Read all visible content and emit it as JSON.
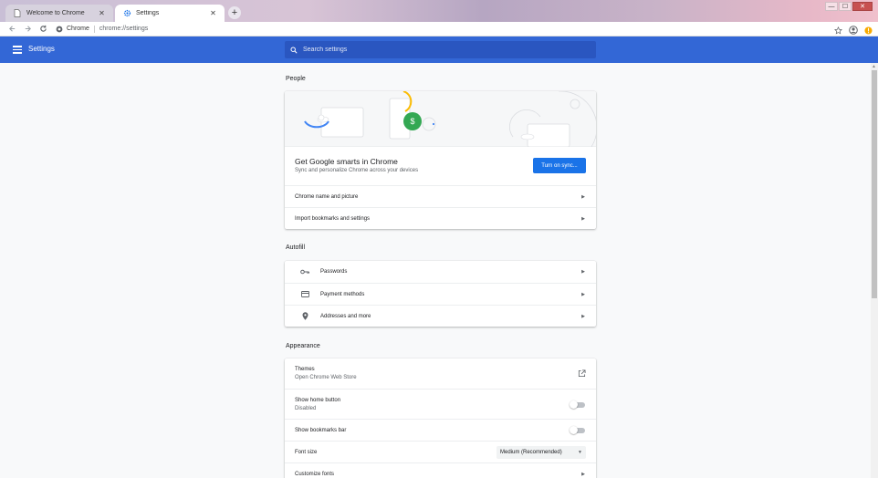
{
  "browser": {
    "tabs": [
      {
        "title": "Welcome to Chrome",
        "active": false
      },
      {
        "title": "Settings",
        "active": true
      }
    ],
    "new_tab_symbol": "+",
    "window_controls": {
      "minimize": "—",
      "maximize": "☐",
      "close": "✕"
    },
    "omnibox": {
      "site": "Chrome",
      "url": "chrome://settings"
    }
  },
  "header": {
    "title": "Settings",
    "search_placeholder": "Search settings",
    "color": "#3367d6"
  },
  "sections": {
    "people": {
      "title": "People",
      "smarts_title": "Get Google smarts in Chrome",
      "smarts_subtitle": "Sync and personalize Chrome across your devices",
      "sync_button": "Turn on sync...",
      "rows": [
        "Chrome name and picture",
        "Import bookmarks and settings"
      ]
    },
    "autofill": {
      "title": "Autofill",
      "rows": [
        {
          "label": "Passwords",
          "icon": "key-icon"
        },
        {
          "label": "Payment methods",
          "icon": "credit-card-icon"
        },
        {
          "label": "Addresses and more",
          "icon": "location-pin-icon"
        }
      ]
    },
    "appearance": {
      "title": "Appearance",
      "themes": {
        "label": "Themes",
        "sub": "Open Chrome Web Store"
      },
      "home_button": {
        "label": "Show home button",
        "sub": "Disabled",
        "enabled": false
      },
      "bookmarks_bar": {
        "label": "Show bookmarks bar",
        "enabled": false
      },
      "font_size": {
        "label": "Font size",
        "value": "Medium (Recommended)"
      },
      "customize_fonts": {
        "label": "Customize fonts"
      }
    }
  },
  "colors": {
    "accent": "#1a73e8",
    "header": "#3367d6",
    "sync_green": "#34a853",
    "banner_yellow": "#fbbc04"
  }
}
